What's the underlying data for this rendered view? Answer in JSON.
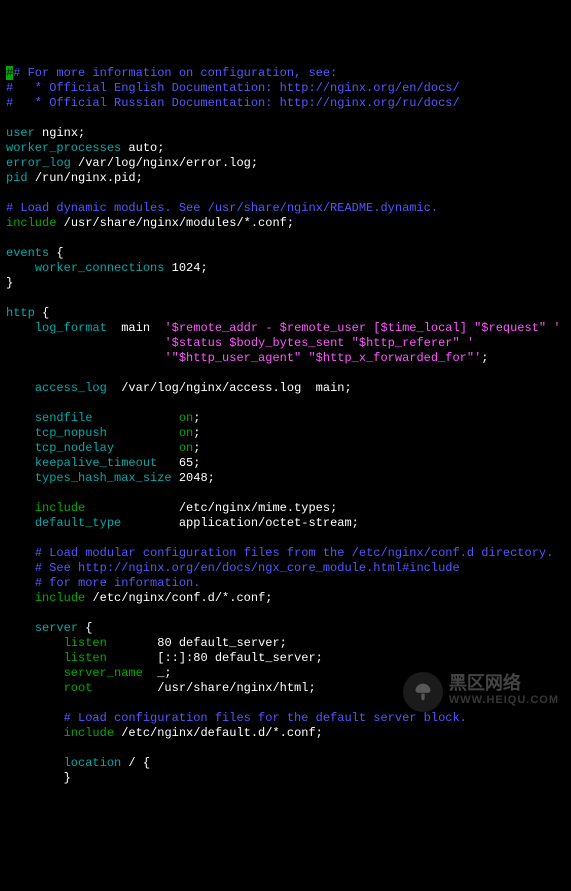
{
  "c1": "# For more information on configuration, see:",
  "c2": "#   * Official English Documentation: http://nginx.org/en/docs/",
  "c3": "#   * Official Russian Documentation: http://nginx.org/ru/docs/",
  "d_user_k": "user",
  "d_user_v": "nginx;",
  "d_wp_k": "worker_processes",
  "d_wp_v": "auto;",
  "d_el_k": "error_log",
  "d_el_v": "/var/log/nginx/error.log;",
  "d_pid_k": "pid",
  "d_pid_v": "/run/nginx.pid;",
  "c4": "# Load dynamic modules. See /usr/share/nginx/README.dynamic.",
  "inc1_k": "include",
  "inc1_v": "/usr/share/nginx/modules/*.conf;",
  "ev_k": "events",
  "ev_ob": "{",
  "wc_k": "worker_connections",
  "wc_v": "1024;",
  "cb": "}",
  "http_k": "http",
  "lf_k": "log_format",
  "lf_name": "main",
  "lf_s1": "'$remote_addr - $remote_user [$time_local] \"$request\" '",
  "lf_s2": "'$status $body_bytes_sent \"$http_referer\" '",
  "lf_s3a": "'\"$http_user_agent\" \"$http_x_forwarded_for\"'",
  "lf_end": ";",
  "al_k": "access_log",
  "al_v": "/var/log/nginx/access.log  main;",
  "sf_k": "sendfile",
  "on": "on",
  "tn_k": "tcp_nopush",
  "tnd_k": "tcp_nodelay",
  "ka_k": "keepalive_timeout",
  "ka_v": "65;",
  "th_k": "types_hash_max_size",
  "th_v": "2048;",
  "inc2_k": "include",
  "inc2_v": "/etc/nginx/mime.types;",
  "dt_k": "default_type",
  "dt_v": "application/octet-stream;",
  "c5": "# Load modular configuration files from the /etc/nginx/conf.d directory.",
  "c6": "# See http://nginx.org/en/docs/ngx_core_module.html#include",
  "c7": "# for more information.",
  "inc3_k": "include",
  "inc3_v": "/etc/nginx/conf.d/*.conf;",
  "srv_k": "server",
  "li_k": "listen",
  "li_v1": "80 default_server;",
  "li_v2": "[::]:80 default_server;",
  "sn_k": "server_name",
  "sn_v": "_;",
  "rt_k": "root",
  "rt_v": "/usr/share/nginx/html;",
  "c8": "# Load configuration files for the default server block.",
  "inc4_k": "include",
  "inc4_v": "/etc/nginx/default.d/*.conf;",
  "loc_k": "location",
  "loc_a": "/ {",
  "wm_t1": "黑区网络",
  "wm_t2": "WWW.HEIQU.COM"
}
